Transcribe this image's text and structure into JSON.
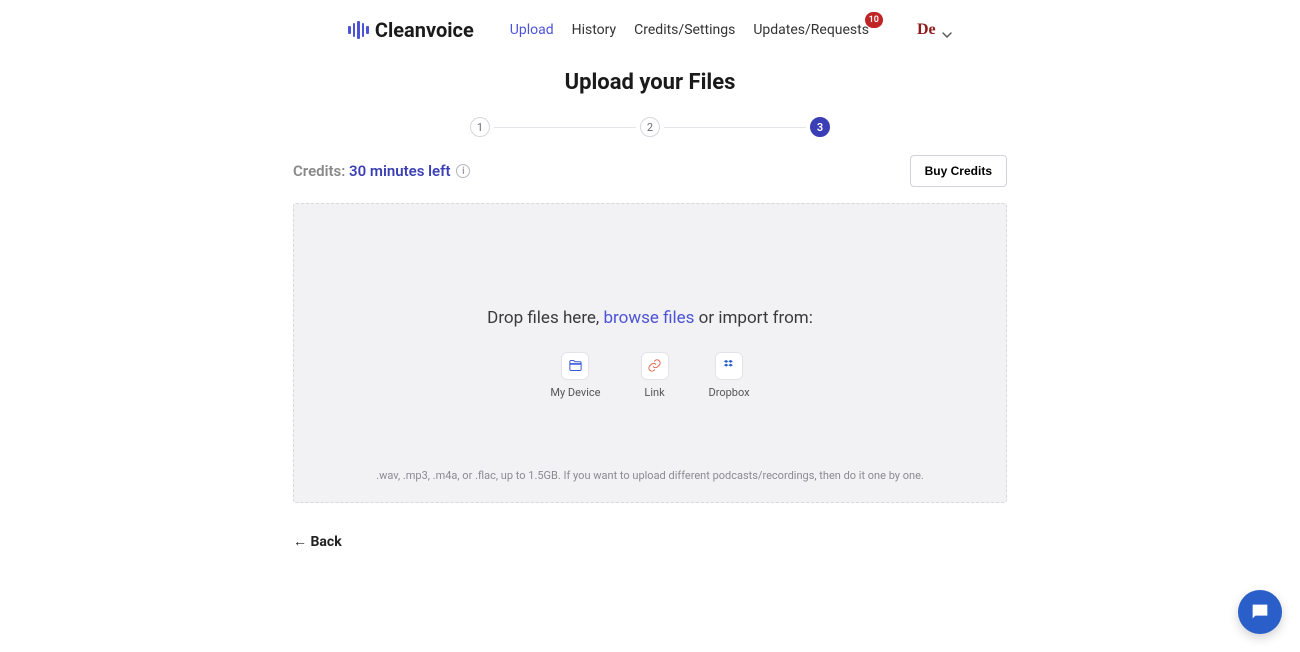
{
  "brand": "Cleanvoice",
  "nav": {
    "upload": "Upload",
    "history": "History",
    "credits_settings": "Credits/Settings",
    "updates_requests": "Updates/Requests",
    "badge_count": "10"
  },
  "account": {
    "initials": "De"
  },
  "page": {
    "title": "Upload your Files"
  },
  "steps": {
    "s1": "1",
    "s2": "2",
    "s3": "3"
  },
  "credits": {
    "label": "Credits: ",
    "amount": "30 minutes left",
    "buy_button": "Buy Credits"
  },
  "drop": {
    "prefix": "Drop files here, ",
    "browse": "browse files",
    "suffix": " or import from:",
    "hint": ".wav, .mp3, .m4a, or .flac, up to 1.5GB. If you want to upload different podcasts/recordings, then do it one by one."
  },
  "import": {
    "device": "My Device",
    "link": "Link",
    "dropbox": "Dropbox"
  },
  "back": {
    "label": "← Back"
  }
}
